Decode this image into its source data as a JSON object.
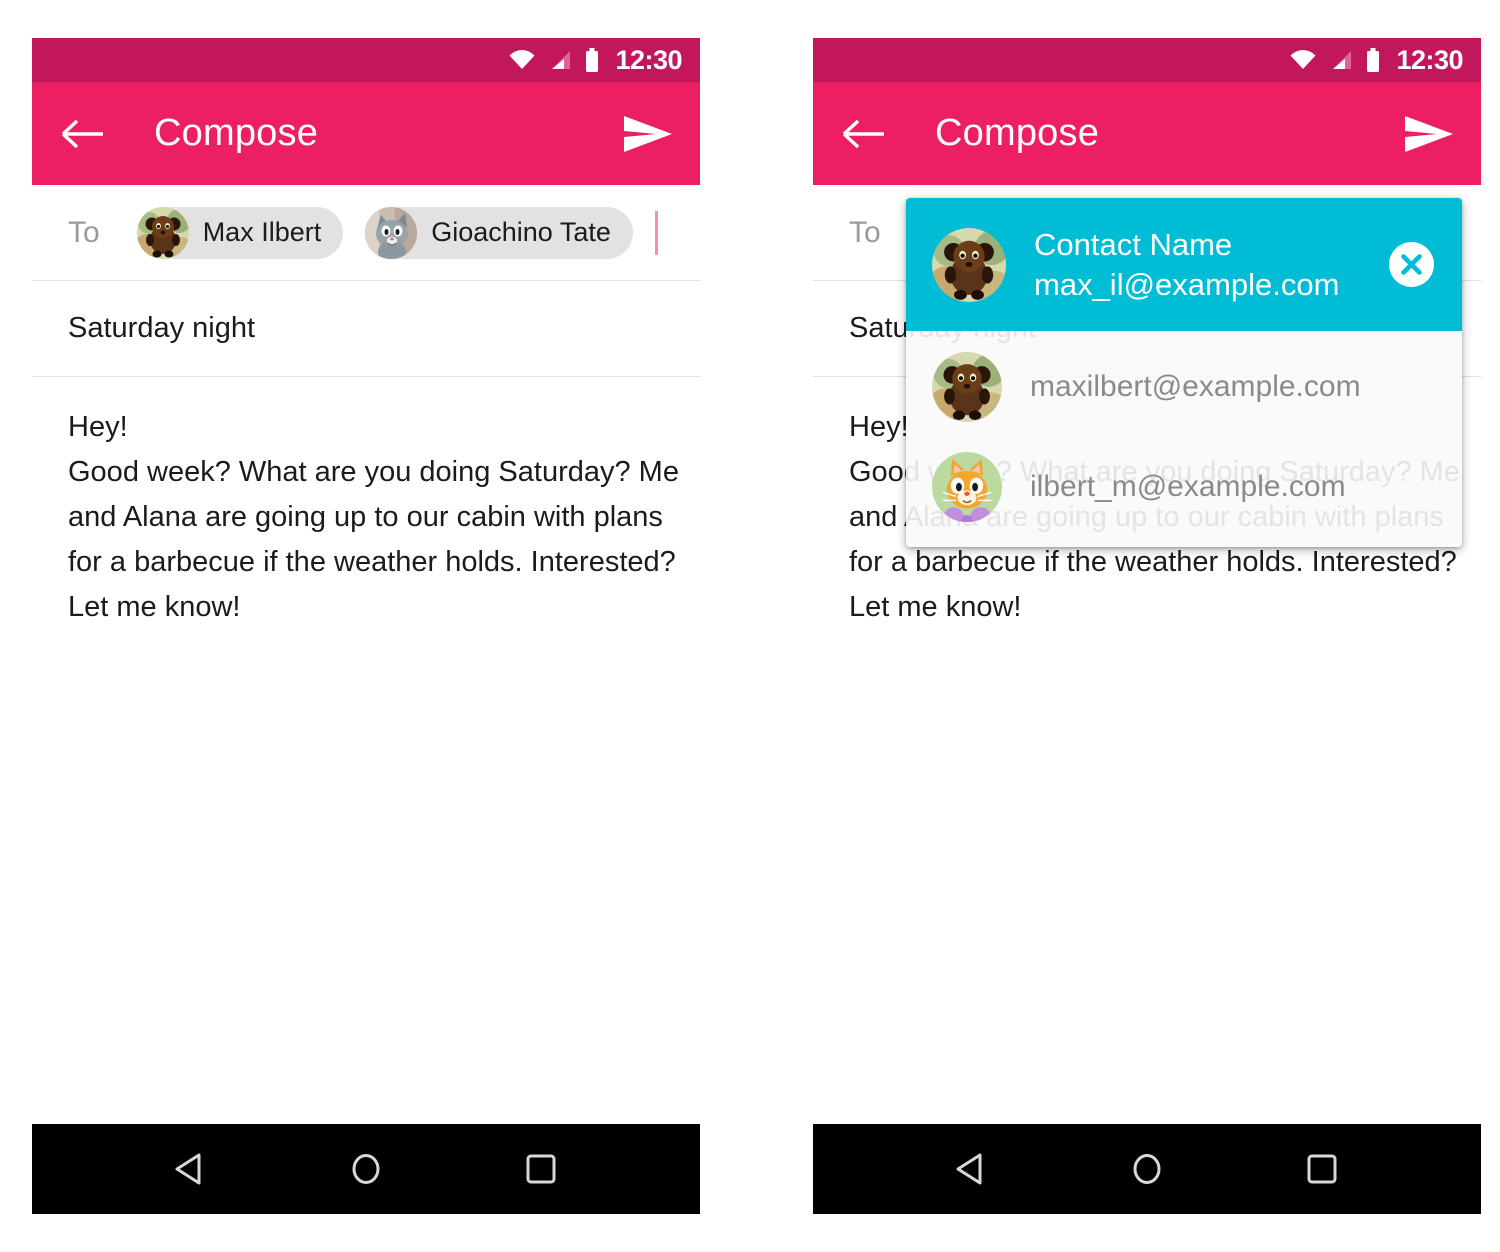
{
  "status_bar": {
    "time": "12:30",
    "icons": [
      "wifi-icon",
      "signal-icon",
      "battery-icon"
    ],
    "bg_color": "#c2185b"
  },
  "app_bar": {
    "title": "Compose",
    "back_icon": "back-arrow-icon",
    "send_icon": "send-icon",
    "bg_color": "#ec1f63"
  },
  "compose": {
    "to_label": "To",
    "recipients": [
      {
        "name": "Max Ilbert",
        "avatar": "bear-avatar"
      },
      {
        "name": "Gioachino Tate",
        "avatar": "gray-cat-avatar"
      }
    ],
    "subject": "Saturday night",
    "body_lines": [
      "Hey!",
      "Good week? What are you doing Saturday? Me",
      "and Alana are going up to our cabin with plans",
      "for a barbecue if the weather holds. Interested?",
      "Let me know!"
    ]
  },
  "popup": {
    "bg_color": "#00bcd4",
    "header": {
      "name": "Contact Name",
      "email": "max_il@example.com",
      "avatar": "bear-avatar",
      "close_icon": "close-icon"
    },
    "items": [
      {
        "email": "maxilbert@example.com",
        "avatar": "bear-avatar"
      },
      {
        "email": "ilbert_m@example.com",
        "avatar": "orange-cat-avatar"
      }
    ]
  },
  "nav_bar": {
    "back": "back-triangle-icon",
    "home": "home-circle-icon",
    "recents": "recents-square-icon",
    "bg_color": "#000000"
  }
}
